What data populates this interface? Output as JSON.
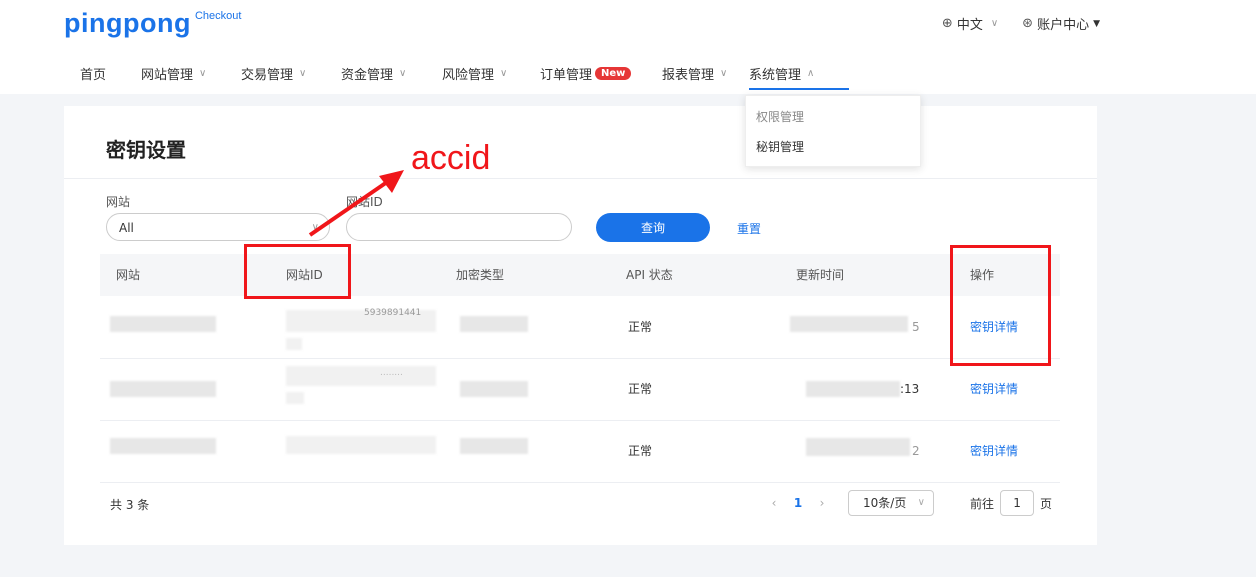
{
  "brand": {
    "name": "pingpong",
    "sub": "Checkout"
  },
  "top_right": {
    "language": "中文",
    "account": "账户中心"
  },
  "nav": [
    {
      "label": "首页",
      "has_chevron": false
    },
    {
      "label": "网站管理",
      "has_chevron": true
    },
    {
      "label": "交易管理",
      "has_chevron": true
    },
    {
      "label": "资金管理",
      "has_chevron": true
    },
    {
      "label": "风险管理",
      "has_chevron": true
    },
    {
      "label": "订单管理",
      "has_chevron": false,
      "badge": "New"
    },
    {
      "label": "报表管理",
      "has_chevron": true
    },
    {
      "label": "系统管理",
      "has_chevron": true,
      "active": true,
      "chevron": "up"
    }
  ],
  "dropdown": {
    "items": [
      "权限管理",
      "秘钥管理"
    ]
  },
  "page": {
    "title": "密钥设置"
  },
  "filters": {
    "site_label": "网站",
    "site_value": "All",
    "site_id_label": "网站ID",
    "site_id_placeholder": "",
    "query_button": "查询",
    "reset_button": "重置"
  },
  "table": {
    "columns": [
      "网站",
      "网站ID",
      "加密类型",
      "API 状态",
      "更新时间",
      "操作"
    ],
    "rows": [
      {
        "site": "",
        "site_id_partial": "5939891441",
        "encrypt": "",
        "api_status": "正常",
        "update_time_partial": "5",
        "action": "密钥详情"
      },
      {
        "site": "",
        "site_id_partial": "........",
        "encrypt": "",
        "api_status": "正常",
        "update_time_partial": ":13",
        "action": "密钥详情"
      },
      {
        "site": "",
        "site_id_partial": "",
        "encrypt": "",
        "api_status": "正常",
        "update_time_partial": "2",
        "action": "密钥详情"
      }
    ]
  },
  "pagination": {
    "total": "共 3 条",
    "current": "1",
    "page_size": "10条/页",
    "goto_label": "前往",
    "goto_value": "1",
    "page_suffix": "页"
  },
  "annotation": {
    "text": "accid",
    "color": "#f0161a"
  },
  "colors": {
    "primary": "#1a73e8",
    "annotation_red": "#f0161a",
    "badge_red": "#e63636"
  }
}
